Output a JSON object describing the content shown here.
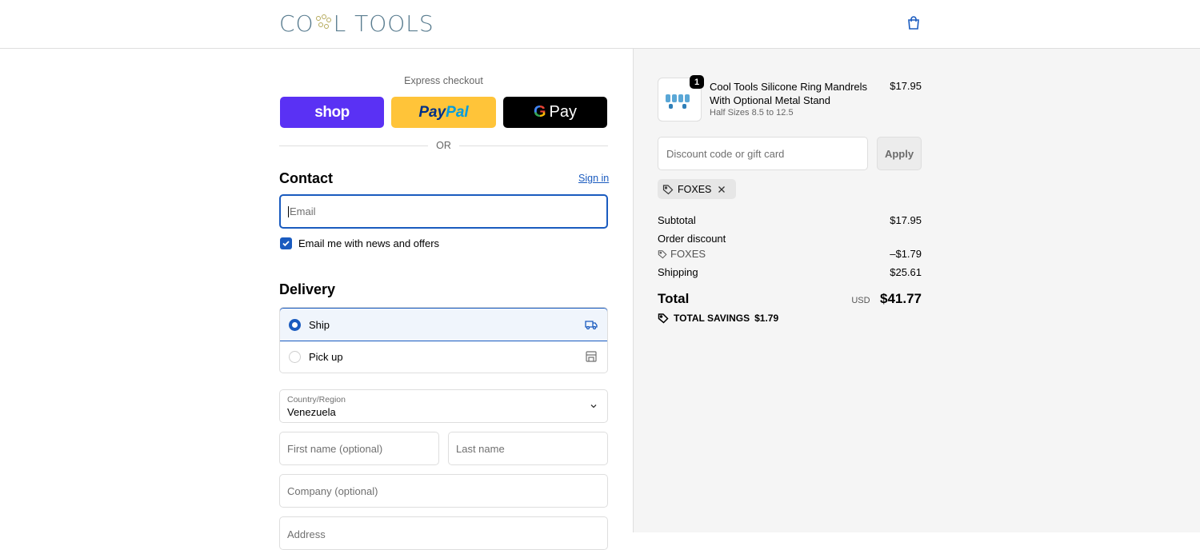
{
  "header": {
    "logo_text_left": "CO",
    "logo_text_right": "L TOOLS",
    "cart_icon": "shopping-bag-icon"
  },
  "express": {
    "title": "Express checkout",
    "shop_label": "shop",
    "paypal_label_1": "Pay",
    "paypal_label_2": "Pal",
    "gpay_label": "Pay",
    "gpay_g": "G",
    "or_text": "OR",
    "shop_color": "#5a31f4",
    "paypal_color": "#ffc439",
    "gpay_color": "#000000"
  },
  "contact": {
    "title": "Contact",
    "sign_in": "Sign in",
    "email_placeholder": "Email",
    "newsletter_label": "Email me with news and offers",
    "newsletter_checked": true
  },
  "delivery": {
    "title": "Delivery",
    "options": [
      {
        "label": "Ship",
        "selected": true,
        "icon": "truck-icon"
      },
      {
        "label": "Pick up",
        "selected": false,
        "icon": "store-icon"
      }
    ],
    "country_label": "Country/Region",
    "country_value": "Venezuela",
    "first_name_placeholder": "First name (optional)",
    "last_name_placeholder": "Last name",
    "company_placeholder": "Company (optional)",
    "address_placeholder": "Address"
  },
  "order": {
    "product": {
      "name": "Cool Tools Silicone Ring Mandrels With Optional Metal Stand",
      "variant": "Half Sizes 8.5 to 12.5",
      "price": "$17.95",
      "quantity": "1"
    },
    "discount_placeholder": "Discount code or gift card",
    "apply_label": "Apply",
    "applied_code": "FOXES",
    "subtotal_label": "Subtotal",
    "subtotal_value": "$17.95",
    "order_discount_label": "Order discount",
    "discount_code": "FOXES",
    "discount_value": "–$1.79",
    "shipping_label": "Shipping",
    "shipping_value": "$25.61",
    "total_label": "Total",
    "currency": "USD",
    "total_value": "$41.77",
    "savings_label": "TOTAL SAVINGS",
    "savings_value": "$1.79"
  },
  "colors": {
    "accent": "#1a5bbf",
    "sidebar_bg": "#f5f5f5"
  }
}
